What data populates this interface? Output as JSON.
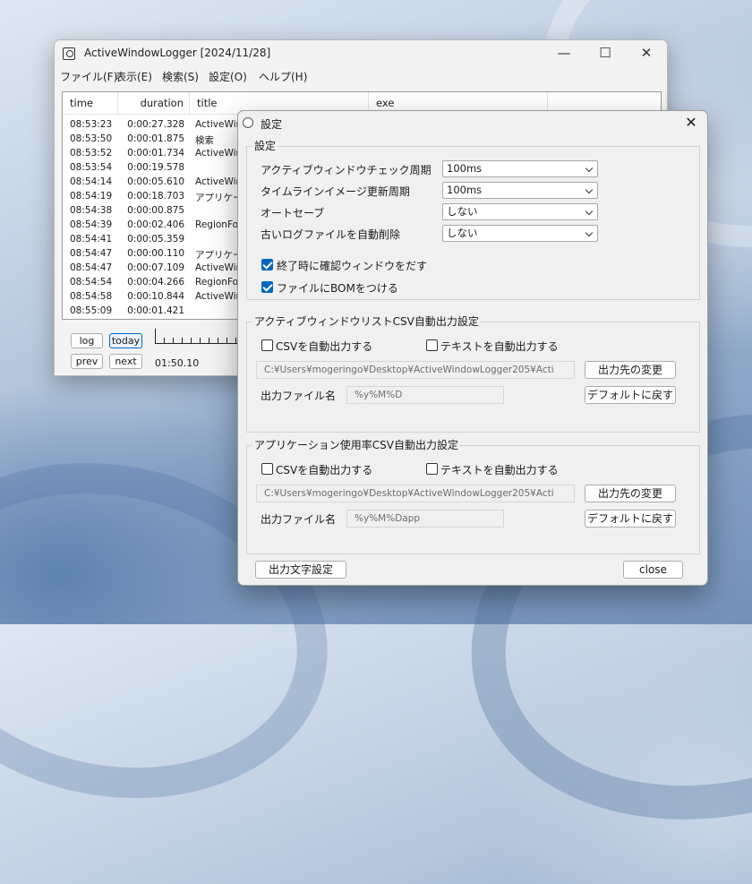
{
  "main_window": {
    "title": "ActiveWindowLogger [2024/11/28]",
    "minimize": "—",
    "maximize": "☐",
    "close": "✕",
    "menu": [
      "ファイル(F)",
      "表示(E)",
      "検索(S)",
      "設定(O)",
      "ヘルプ(H)"
    ],
    "columns": [
      "time",
      "duration",
      "title",
      "exe"
    ],
    "rows": [
      {
        "time": "08:53:23",
        "duration": "0:00:27.328",
        "title": "ActiveWin"
      },
      {
        "time": "08:53:50",
        "duration": "0:00:01.875",
        "title": "検索"
      },
      {
        "time": "08:53:52",
        "duration": "0:00:01.734",
        "title": "ActiveWin"
      },
      {
        "time": "08:53:54",
        "duration": "0:00:19.578",
        "title": ""
      },
      {
        "time": "08:54:14",
        "duration": "0:00:05.610",
        "title": "ActiveWin"
      },
      {
        "time": "08:54:19",
        "duration": "0:00:18.703",
        "title": "アプリケーシ"
      },
      {
        "time": "08:54:38",
        "duration": "0:00:00.875",
        "title": ""
      },
      {
        "time": "08:54:39",
        "duration": "0:00:02.406",
        "title": "RegionFo"
      },
      {
        "time": "08:54:41",
        "duration": "0:00:05.359",
        "title": ""
      },
      {
        "time": "08:54:47",
        "duration": "0:00:00.110",
        "title": "アプリケーシ"
      },
      {
        "time": "08:54:47",
        "duration": "0:00:07.109",
        "title": "ActiveWin"
      },
      {
        "time": "08:54:54",
        "duration": "0:00:04.266",
        "title": "RegionFo"
      },
      {
        "time": "08:54:58",
        "duration": "0:00:10.844",
        "title": "ActiveWin"
      },
      {
        "time": "08:55:09",
        "duration": "0:00:01.421",
        "title": ""
      }
    ],
    "buttons": {
      "log": "log",
      "today": "today",
      "prev": "prev",
      "next": "next"
    },
    "timeline_time": "01:50.10"
  },
  "dialog": {
    "title": "設定",
    "close": "✕",
    "general": {
      "group_label": "設定",
      "settings": [
        {
          "label": "アクティブウィンドウチェック周期",
          "value": "100ms"
        },
        {
          "label": "タイムラインイメージ更新周期",
          "value": "100ms"
        },
        {
          "label": "オートセーブ",
          "value": "しない"
        },
        {
          "label": "古いログファイルを自動削除",
          "value": "しない"
        }
      ],
      "confirm_on_exit": "終了時に確認ウィンドウをだす",
      "add_bom": "ファイルにBOMをつける"
    },
    "window_csv": {
      "group_label": "アクティブウィンドウリストCSV自動出力設定",
      "csv_auto": "CSVを自動出力する",
      "text_auto": "テキストを自動出力する",
      "path": "C:¥Users¥mogeringo¥Desktop¥ActiveWindowLogger205¥Acti",
      "change_dest": "出力先の変更",
      "filename_label": "出力ファイル名",
      "filename": "%y%M%D",
      "reset": "デフォルトに戻す"
    },
    "app_csv": {
      "group_label": "アプリケーション使用率CSV自動出力設定",
      "csv_auto": "CSVを自動出力する",
      "text_auto": "テキストを自動出力する",
      "path": "C:¥Users¥mogeringo¥Desktop¥ActiveWindowLogger205¥Acti",
      "change_dest": "出力先の変更",
      "filename_label": "出力ファイル名",
      "filename": "%y%M%Dapp",
      "reset": "デフォルトに戻す"
    },
    "output_charset": "出力文字設定",
    "close_button": "close"
  }
}
